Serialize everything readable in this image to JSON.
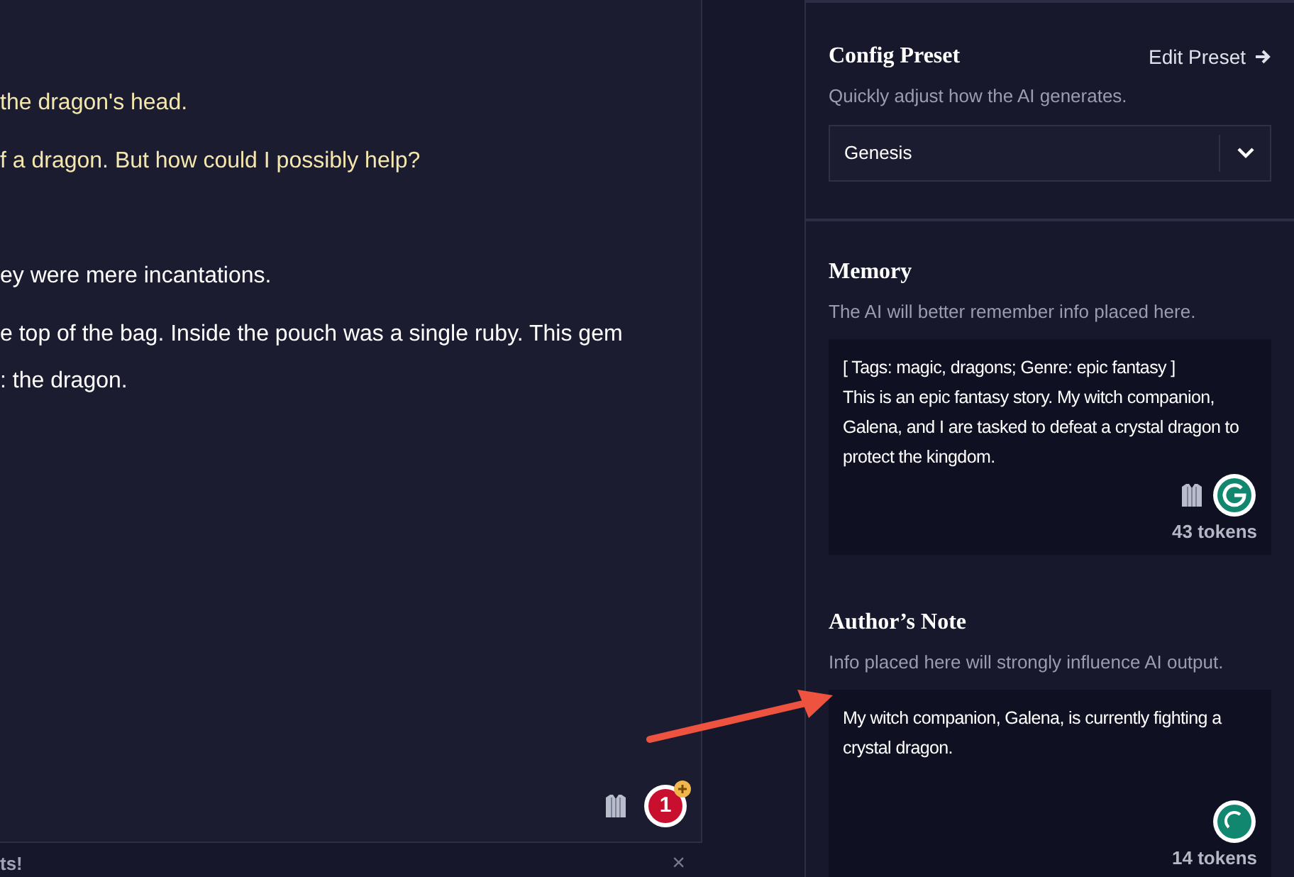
{
  "story": {
    "paragraphs": [
      {
        "kind": "user",
        "text": "the dragon's head."
      },
      {
        "kind": "user",
        "text": "f a dragon. But how could I possibly help?"
      },
      {
        "kind": "ai",
        "text": "ey were mere incantations."
      },
      {
        "kind": "ai",
        "text": "e top of the bag. Inside the pouch was a single ruby. This gem\n: the dragon."
      }
    ],
    "badge_count": "1"
  },
  "footer": {
    "text": "ts!",
    "close": "×"
  },
  "sidebar": {
    "config_preset": {
      "title": "Config Preset",
      "link": "Edit Preset",
      "description": "Quickly adjust how the AI generates.",
      "value": "Genesis"
    },
    "memory": {
      "title": "Memory",
      "description": "The AI will better remember info placed here.",
      "value": "[ Tags: magic, dragons; Genre: epic fantasy ]\nThis is an epic fantasy story. My witch companion, Galena, and I are tasked to defeat a crystal dragon to protect the kingdom.",
      "tokens": "43 tokens"
    },
    "authors_note": {
      "title": "Author’s Note",
      "description": "Info placed here will strongly influence AI output.",
      "value": "My witch companion, Galena, is currently fighting a crystal dragon.",
      "tokens": "14 tokens"
    }
  }
}
